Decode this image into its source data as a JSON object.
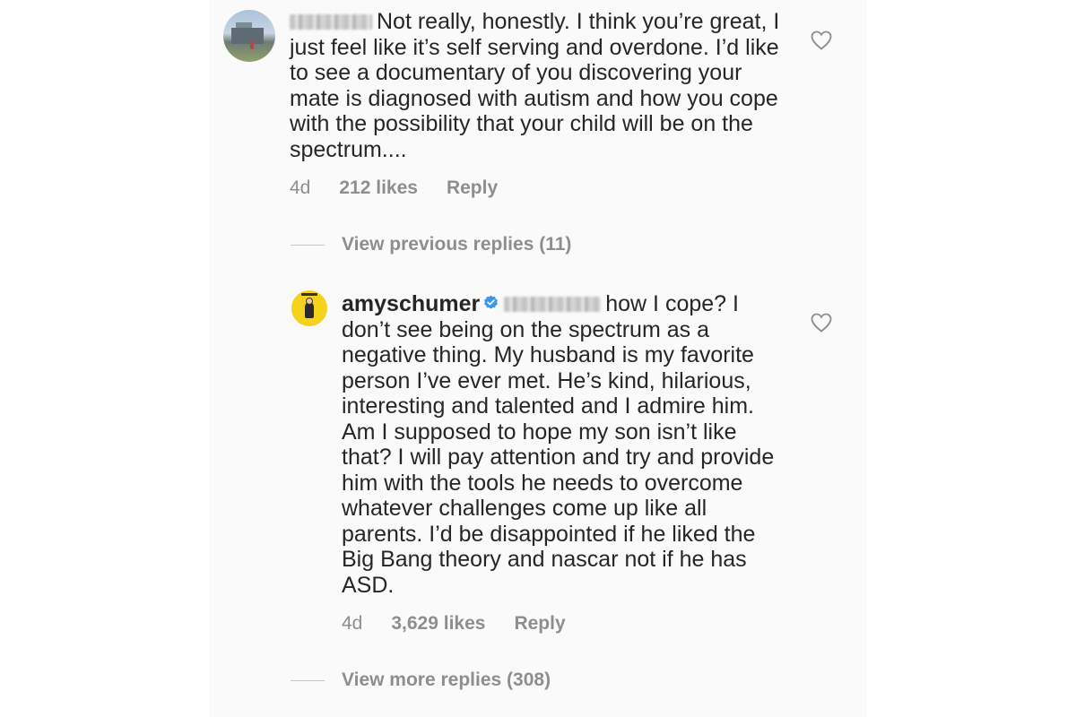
{
  "comments": [
    {
      "username_blurred": true,
      "text": "Not really, honestly. I think you’re great, I just feel like it’s self serving and overdone. I’d like to see a documentary of you discovering your mate is diagnosed with autism and how you cope with the possibility that your child will be on the spectrum....",
      "time": "4d",
      "likes": "212 likes",
      "reply_label": "Reply",
      "view_replies": "View previous replies (11)"
    },
    {
      "username": "amyschumer",
      "verified": true,
      "mention_blurred": true,
      "text": "how I cope? I don’t see being on the spectrum as a negative thing. My husband is my favorite person I’ve ever met. He’s kind, hilarious, interesting and talented and I admire him. Am I supposed to hope my son isn’t like that? I will pay attention and try and provide him with the tools he needs to overcome whatever challenges come up like all parents. I’d be disappointed if he liked the Big Bang theory and nascar not if he has ASD.",
      "time": "4d",
      "likes": "3,629 likes",
      "reply_label": "Reply",
      "view_replies": "View more replies (308)"
    }
  ],
  "icons": {
    "like": "heart-outline-icon",
    "verified": "verified-badge-icon",
    "verified_color": "#3897f0"
  }
}
